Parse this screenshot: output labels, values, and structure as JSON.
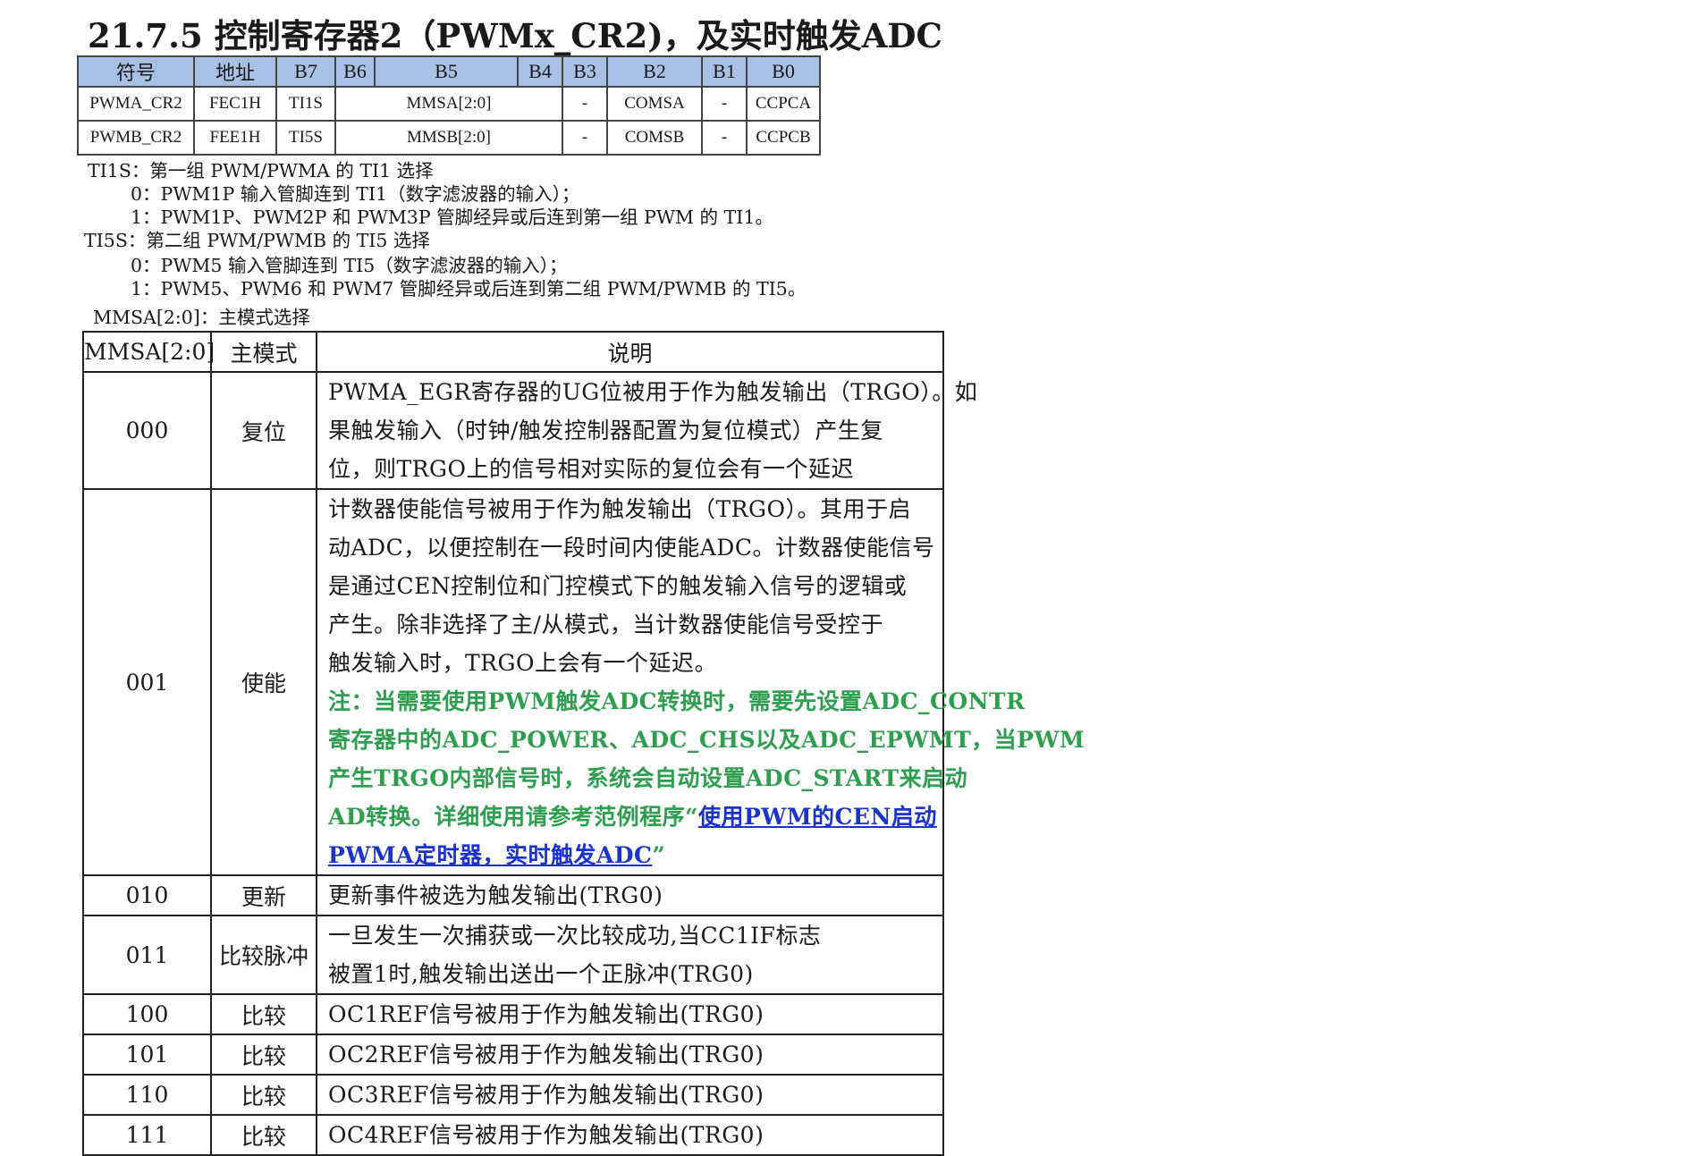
{
  "heading": "21.7.5 控制寄存器2（PWMx_CR2)，及实时触发ADC",
  "register_table": {
    "headers": [
      "符号",
      "地址",
      "B7",
      "B6",
      "B5",
      "B4",
      "B3",
      "B2",
      "B1",
      "B0"
    ],
    "rows": [
      {
        "symbol": "PWMA_CR2",
        "address": "FEC1H",
        "b7": "TI1S",
        "b6_b4": "MMSA[2:0]",
        "b3": "-",
        "b2": "COMSA",
        "b1": "-",
        "b0": "CCPCA"
      },
      {
        "symbol": "PWMB_CR2",
        "address": "FEE1H",
        "b7": "TI5S",
        "b6_b4": "MMSB[2:0]",
        "b3": "-",
        "b2": "COMSB",
        "b1": "-",
        "b0": "CCPCB"
      }
    ],
    "header_color": "#a8c0e3"
  },
  "descriptions": [
    "TI1S：第一组 PWM/PWMA 的 TI1 选择",
    "0：PWM1P 输入管脚连到 TI1（数字滤波器的输入）；",
    "1：PWM1P、PWM2P 和 PWM3P 管脚经异或后连到第一组 PWM 的 TI1。",
    "TI5S：第二组 PWM/PWMB 的 TI5 选择",
    "0：PWM5 输入管脚连到 TI5（数字滤波器的输入）；",
    "1：PWM5、PWM6 和 PWM7 管脚经异或后连到第二组 PWM/PWMB 的 TI5。",
    "MMSA[2:0]：主模式选择"
  ],
  "mmsa_table": {
    "headers": [
      "MMSA[2:0]",
      "主模式",
      "说明"
    ],
    "rows": [
      {
        "code": "000",
        "mode": "复位",
        "lines": [
          "PWMA_EGR寄存器的UG位被用于作为触发输出（TRGO）。如",
          "果触发输入（时钟/触发控制器配置为复位模式）产生复",
          "位，则TRGO上的信号相对实际的复位会有一个延迟"
        ]
      },
      {
        "code": "001",
        "mode": "使能",
        "lines": [
          "计数器使能信号被用于作为触发输出（TRGO）。其用于启",
          "动ADC，以便控制在一段时间内使能ADC。计数器使能信号",
          "是通过CEN控制位和门控模式下的触发输入信号的逻辑或",
          "产生。除非选择了主/从模式，当计数器使能信号受控于",
          "触发输入时，TRGO上会有一个延迟。"
        ],
        "note_lines": [
          "注：当需要使用PWM触发ADC转换时，需要先设置ADC_CONTR",
          "寄存器中的ADC_POWER、ADC_CHS以及ADC_EPWMT，当PWM",
          "产生TRGO内部信号时，系统会自动设置ADC_START来启动",
          "AD转换。详细使用请参考范例程序"
        ],
        "link_open": "“",
        "link_lines": [
          "使用PWM的CEN启动",
          "PWMA定时器，实时触发ADC"
        ],
        "link_close": "”",
        "note_color": "#2e9e4f",
        "link_color": "#1a33cc"
      },
      {
        "code": "010",
        "mode": "更新",
        "lines": [
          "更新事件被选为触发输出(TRG0)"
        ]
      },
      {
        "code": "011",
        "mode": "比较脉冲",
        "lines": [
          "一旦发生一次捕获或一次比较成功,当CC1IF标志",
          "被置1时,触发输出送出一个正脉冲(TRG0)"
        ]
      },
      {
        "code": "100",
        "mode": "比较",
        "lines": [
          "OC1REF信号被用于作为触发输出(TRG0)"
        ]
      },
      {
        "code": "101",
        "mode": "比较",
        "lines": [
          "OC2REF信号被用于作为触发输出(TRG0)"
        ]
      },
      {
        "code": "110",
        "mode": "比较",
        "lines": [
          "OC3REF信号被用于作为触发输出(TRG0)"
        ]
      },
      {
        "code": "111",
        "mode": "比较",
        "lines": [
          "OC4REF信号被用于作为触发输出(TRG0)"
        ]
      }
    ]
  }
}
